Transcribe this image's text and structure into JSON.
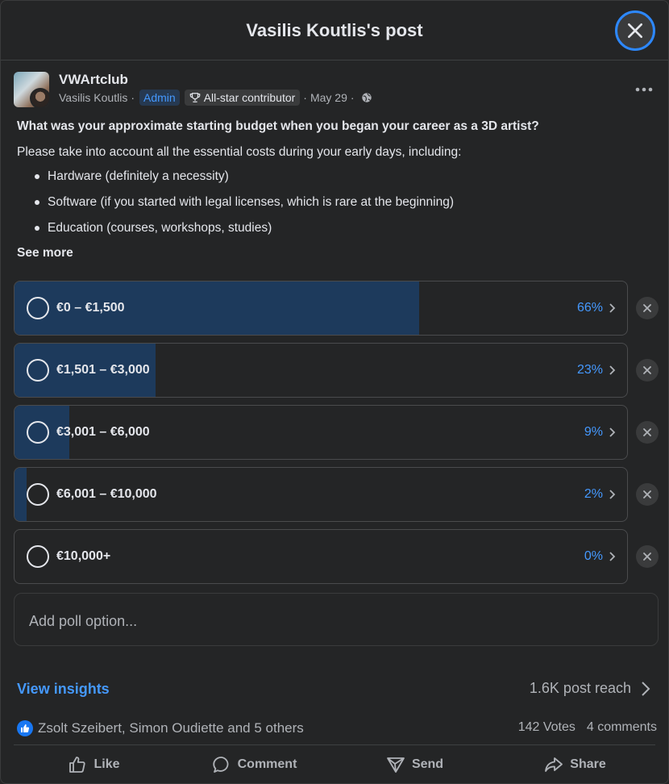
{
  "header": {
    "title": "Vasilis Koutlis's post"
  },
  "post": {
    "group_name": "VWArtclub",
    "author": "Vasilis Koutlis",
    "role_badge": "Admin",
    "contributor_badge": "All-star contributor",
    "date": "May 29",
    "privacy_icon": "globe-icon",
    "question": "What was your approximate starting budget when you began your career as a 3D artist?",
    "intro": "Please take into account all the essential costs during your early days, including:",
    "bullets": [
      "Hardware (definitely a necessity)",
      "Software (if you started with legal licenses, which is rare at the beginning)",
      "Education (courses, workshops, studies)"
    ],
    "see_more": "See more"
  },
  "poll": {
    "options": [
      {
        "label": "€0 – €1,500",
        "percent_label": "66%",
        "fill_fraction": 0.66
      },
      {
        "label": "€1,501 – €3,000",
        "percent_label": "23%",
        "fill_fraction": 0.23
      },
      {
        "label": "€3,001 – €6,000",
        "percent_label": "9%",
        "fill_fraction": 0.09
      },
      {
        "label": "€6,001 – €10,000",
        "percent_label": "2%",
        "fill_fraction": 0.02
      },
      {
        "label": "€10,000+",
        "percent_label": "0%",
        "fill_fraction": 0.0
      }
    ],
    "add_option_placeholder": "Add poll option..."
  },
  "insights": {
    "label": "View insights",
    "reach": "1.6K post reach"
  },
  "engagement": {
    "reactions_text": "Zsolt Szeibert, Simon Oudiette and 5 others",
    "votes": "142 Votes",
    "comments": "4 comments"
  },
  "actions": {
    "like": "Like",
    "comment": "Comment",
    "send": "Send",
    "share": "Share"
  },
  "colors": {
    "accent": "#4599ff",
    "poll_fill": "#1d3a5c",
    "background": "#242526"
  }
}
